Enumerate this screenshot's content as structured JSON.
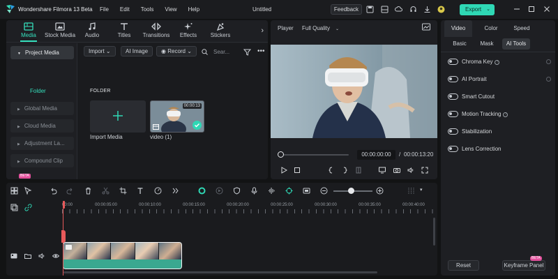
{
  "titlebar": {
    "app_name": "Wondershare Filmora 13 Beta",
    "menu": [
      "File",
      "Edit",
      "Tools",
      "View",
      "Help"
    ],
    "doc_title": "Untitled",
    "feedback_label": "Feedback",
    "export_label": "Export",
    "accent_color": "#2fd8b5"
  },
  "media_tabs": [
    {
      "label": "Media",
      "icon": "media-icon"
    },
    {
      "label": "Stock Media",
      "icon": "stock-media-icon"
    },
    {
      "label": "Audio",
      "icon": "music-note-icon"
    },
    {
      "label": "Titles",
      "icon": "text-t-icon"
    },
    {
      "label": "Transitions",
      "icon": "transitions-icon"
    },
    {
      "label": "Effects",
      "icon": "sparkle-icon"
    },
    {
      "label": "Stickers",
      "icon": "sticker-icon"
    }
  ],
  "sidebar": {
    "project_media": "Project Media",
    "folder": "Folder",
    "items": [
      "Global Media",
      "Cloud Media",
      "Adjustment La...",
      "Compound Clip"
    ],
    "compound_badge": "BETA"
  },
  "toolbar": {
    "import_label": "Import",
    "ai_image_label": "AI Image",
    "record_label": "Record",
    "search_placeholder": "Sear..."
  },
  "media": {
    "folder_heading": "FOLDER",
    "import_tile_label": "Import Media",
    "video_label": "video (1)",
    "video_duration": "00:00:13"
  },
  "player": {
    "label": "Player",
    "quality": "Full Quality",
    "current_time": "00:00:00:00",
    "separator": "/",
    "total_time": "00:00:13:20",
    "progress": 0
  },
  "properties": {
    "tabs": [
      "Video",
      "Color",
      "Speed"
    ],
    "subtabs": [
      "Basic",
      "Mask",
      "AI Tools"
    ],
    "ai_tools": [
      {
        "label": "Chroma Key",
        "help": true,
        "enabled": false
      },
      {
        "label": "AI Portrait",
        "help": false,
        "enabled": false
      },
      {
        "label": "Smart Cutout",
        "help": false,
        "enabled": false
      },
      {
        "label": "Motion Tracking",
        "help": true,
        "enabled": false
      },
      {
        "label": "Stabilization",
        "help": false,
        "enabled": false
      },
      {
        "label": "Lens Correction",
        "help": false,
        "enabled": false
      }
    ],
    "help_glyph": "?",
    "reset_label": "Reset",
    "keyframe_label": "Keyframe Panel",
    "keyframe_badge": "BETA"
  },
  "timeline": {
    "ruler_labels": [
      "00:00",
      "00:00:05:00",
      "00:00:10:00",
      "00:00:15:00",
      "00:00:20:00",
      "00:00:25:00",
      "00:00:30:00",
      "00:00:35:00",
      "00:00:40:00"
    ],
    "zoom_level": 0.5
  }
}
